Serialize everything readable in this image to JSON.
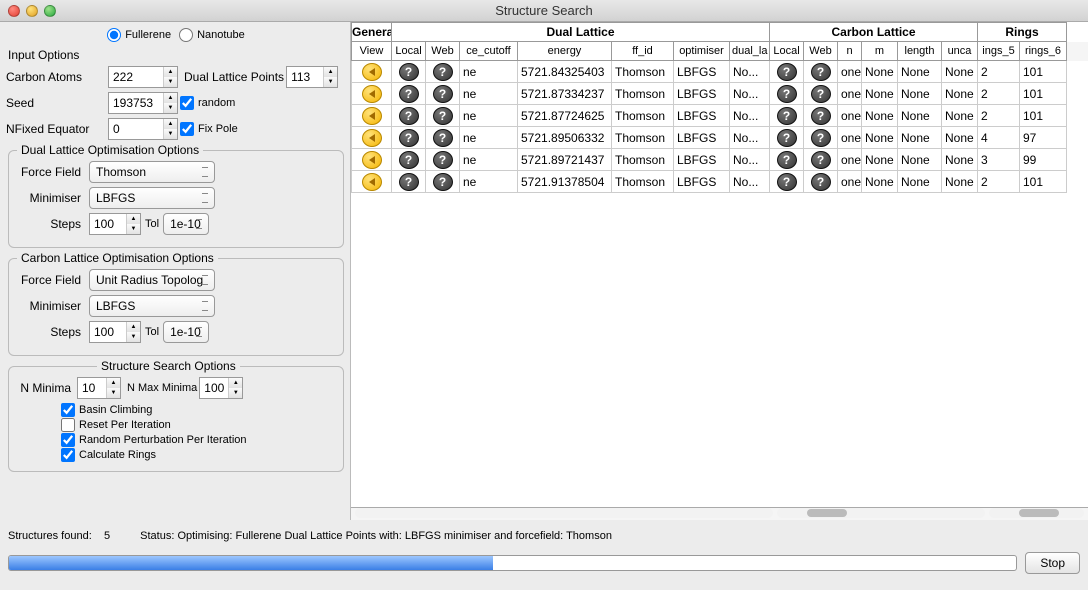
{
  "window": {
    "title": "Structure Search"
  },
  "radios": {
    "fullerene": "Fullerene",
    "nanotube": "Nanotube",
    "selected": "fullerene"
  },
  "input_options": {
    "label": "Input Options",
    "carbon_atoms": {
      "label": "Carbon Atoms",
      "value": "222"
    },
    "dual_points": {
      "label": "Dual Lattice Points",
      "value": "113"
    },
    "seed": {
      "label": "Seed",
      "value": "193753",
      "random_label": "random",
      "random_checked": true
    },
    "nfixed": {
      "label": "NFixed Equator",
      "value": "0",
      "fixpole_label": "Fix Pole",
      "fixpole_checked": true
    }
  },
  "dual_opt": {
    "legend": "Dual Lattice Optimisation Options",
    "force_field": {
      "label": "Force Field",
      "value": "Thomson"
    },
    "minimiser": {
      "label": "Minimiser",
      "value": "LBFGS"
    },
    "steps": {
      "label": "Steps",
      "value": "100",
      "tol_label": "Tol",
      "tol_value": "1e-10"
    }
  },
  "carbon_opt": {
    "legend": "Carbon Lattice Optimisation Options",
    "force_field": {
      "label": "Force Field",
      "value": "Unit Radius Topolog"
    },
    "minimiser": {
      "label": "Minimiser",
      "value": "LBFGS"
    },
    "steps": {
      "label": "Steps",
      "value": "100",
      "tol_label": "Tol",
      "tol_value": "1e-10"
    }
  },
  "ss_opt": {
    "legend": "Structure Search Options",
    "n_minima": {
      "label": "N Minima",
      "value": "10"
    },
    "n_max": {
      "label": "N Max Minima",
      "value": "100"
    },
    "basin": {
      "label": "Basin Climbing",
      "checked": true
    },
    "reset": {
      "label": "Reset Per Iteration",
      "checked": false
    },
    "random_perturb": {
      "label": "Random Perturbation Per Iteration",
      "checked": true
    },
    "calc_rings": {
      "label": "Calculate Rings",
      "checked": true
    }
  },
  "table": {
    "groups": {
      "general": "General",
      "dual": "Dual Lattice",
      "carbon": "Carbon Lattice",
      "rings": "Rings"
    },
    "cols": {
      "view": "View",
      "local": "Local",
      "web": "Web",
      "cutoff": "ce_cutoff",
      "energy": "energy",
      "ff": "ff_id",
      "optimiser": "optimiser",
      "dual_la": "dual_la",
      "local2": "Local",
      "web2": "Web",
      "n": "n",
      "m": "m",
      "length": "length",
      "unca": "unca",
      "rings5": "ings_5",
      "rings6": "rings_6"
    },
    "rows": [
      {
        "cutoff": "ne",
        "energy": "5721.84325403",
        "ff": "Thomson",
        "opt": "LBFGS",
        "dl": "No...",
        "n": "one",
        "m": "None",
        "len": "None",
        "unc": "None",
        "r5": "2",
        "r6": "101"
      },
      {
        "cutoff": "ne",
        "energy": "5721.87334237",
        "ff": "Thomson",
        "opt": "LBFGS",
        "dl": "No...",
        "n": "one",
        "m": "None",
        "len": "None",
        "unc": "None",
        "r5": "2",
        "r6": "101"
      },
      {
        "cutoff": "ne",
        "energy": "5721.87724625",
        "ff": "Thomson",
        "opt": "LBFGS",
        "dl": "No...",
        "n": "one",
        "m": "None",
        "len": "None",
        "unc": "None",
        "r5": "2",
        "r6": "101"
      },
      {
        "cutoff": "ne",
        "energy": "5721.89506332",
        "ff": "Thomson",
        "opt": "LBFGS",
        "dl": "No...",
        "n": "one",
        "m": "None",
        "len": "None",
        "unc": "None",
        "r5": "4",
        "r6": "97"
      },
      {
        "cutoff": "ne",
        "energy": "5721.89721437",
        "ff": "Thomson",
        "opt": "LBFGS",
        "dl": "No...",
        "n": "one",
        "m": "None",
        "len": "None",
        "unc": "None",
        "r5": "3",
        "r6": "99"
      },
      {
        "cutoff": "ne",
        "energy": "5721.91378504",
        "ff": "Thomson",
        "opt": "LBFGS",
        "dl": "No...",
        "n": "one",
        "m": "None",
        "len": "None",
        "unc": "None",
        "r5": "2",
        "r6": "101"
      }
    ]
  },
  "status": {
    "structures_label": "Structures found:",
    "structures_count": "5",
    "status_label": "Status:",
    "status_text": "Optimising: Fullerene Dual Lattice Points with: LBFGS minimiser and forcefield: Thomson"
  },
  "stop_button": "Stop"
}
